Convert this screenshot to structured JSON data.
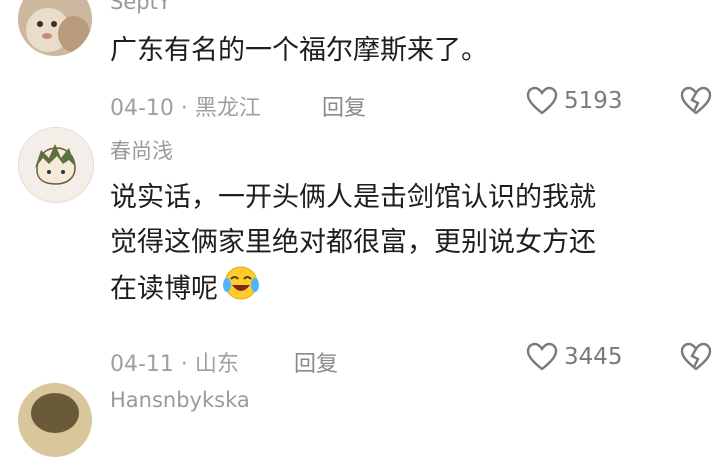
{
  "comments": [
    {
      "username": "SeptY",
      "lines": [
        "广东有名的一个福尔摩斯来了。"
      ],
      "date": "04-10",
      "location": "黑龙江",
      "reply_label": "回复",
      "likes": "5193",
      "avatar_icon": "cat-avatar"
    },
    {
      "username": "春尚浅",
      "lines": [
        "说实话，一开头俩人是击剑馆认识的我就",
        "觉得这俩家里绝对都很富，更别说女方还",
        "在读博呢"
      ],
      "emoji": "crying-laughing-emoji",
      "date": "04-11",
      "location": "山东",
      "reply_label": "回复",
      "likes": "3445",
      "avatar_icon": "anime-character-avatar"
    },
    {
      "username": "Hansnbykska",
      "avatar_icon": "partial-avatar"
    }
  ],
  "meta_separator": " · ",
  "colors": {
    "text": "#1e1e1e",
    "secondary": "#a0a0a0",
    "icon": "#7a7a7a"
  }
}
